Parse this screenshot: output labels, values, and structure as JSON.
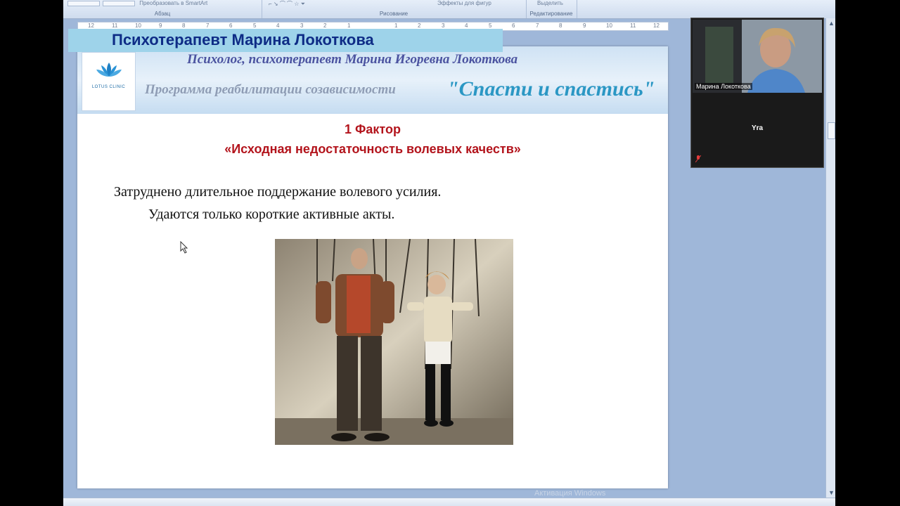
{
  "ribbon": {
    "groups": [
      {
        "label": "Абзац",
        "buttons_text": "Преобразовать в SmartArt"
      },
      {
        "label": "Рисование",
        "buttons_text": ""
      },
      {
        "label": "Редактирование",
        "buttons_text": "Выделить"
      }
    ],
    "effects_text": "Эффекты для фигур"
  },
  "ruler": {
    "ticks": [
      "12",
      "11",
      "10",
      "9",
      "8",
      "7",
      "6",
      "5",
      "4",
      "3",
      "2",
      "1",
      "",
      "1",
      "2",
      "3",
      "4",
      "5",
      "6",
      "7",
      "8",
      "9",
      "10",
      "11",
      "12"
    ]
  },
  "banner": {
    "title": "Психотерапевт Марина Локоткова"
  },
  "slide": {
    "logo_text": "LOTUS CLINIC",
    "header_line1": "Психолог, психотерапевт Марина Игоревна Локоткова",
    "header_program": "Программа реабилитации созависимости",
    "header_program_name": "\"Спасти и спастись\"",
    "factor_title": "1 Фактор",
    "factor_subtitle": "«Исходная недостаточность волевых качеств»",
    "body_line1": "Затруднено длительное поддержание волевого усилия.",
    "body_line2": "Удаются только короткие активные акты."
  },
  "video": {
    "participant1_name": "Марина Локоткова",
    "participant2_name": "Yra"
  },
  "status": {
    "watermark": "Активация Windows"
  },
  "colors": {
    "banner_bg": "#9ed3ea",
    "banner_text": "#0e2c86",
    "factor_red": "#b3141c",
    "program_name_blue": "#2b97c4"
  }
}
